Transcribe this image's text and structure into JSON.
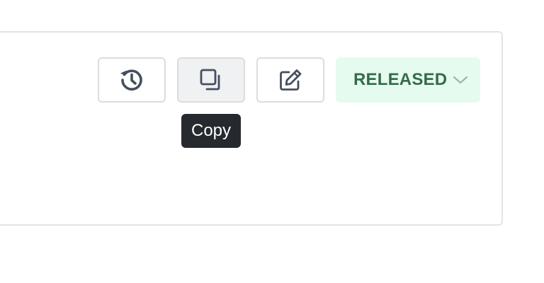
{
  "toolbar": {
    "history_icon": "history-icon",
    "copy_icon": "copy-icon",
    "edit_icon": "edit-icon"
  },
  "status": {
    "label": "RELEASED",
    "icon": "chevron-down-icon",
    "text_color": "#356b4c",
    "background": "#e6fbef"
  },
  "tooltip": {
    "text": "Copy"
  },
  "colors": {
    "icon": "#454f5e",
    "border": "#dcdcdc",
    "tooltip_bg": "#26292d"
  }
}
